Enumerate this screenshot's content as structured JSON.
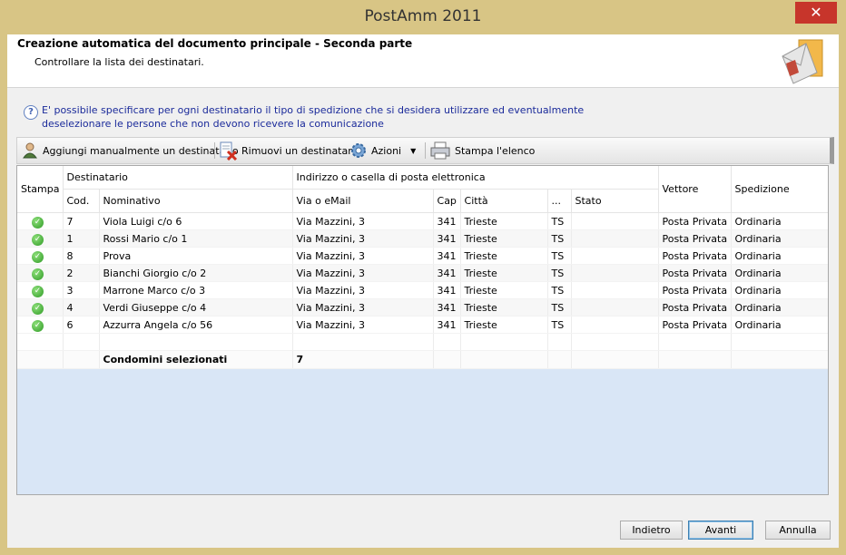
{
  "window": {
    "title": "PostAmm 2011",
    "close_glyph": "✕"
  },
  "header": {
    "title": "Creazione automatica del documento principale - Seconda parte",
    "subtitle": "Controllare la lista dei destinatari."
  },
  "info": {
    "icon": "question-icon",
    "text": "E' possibile specificare per ogni destinatario il tipo di spedizione che si desidera utilizzare ed eventualmente deselezionare le persone che non devono ricevere la comunicazione"
  },
  "toolbar": {
    "add_label": "Aggiungi manualmente un destinatario",
    "remove_label": "Rimuovi un destinatario",
    "actions_label": "Azioni",
    "print_label": "Stampa l'elenco"
  },
  "grid": {
    "group_headers": {
      "stampa": "Stampa",
      "destinatario": "Destinatario",
      "indirizzo": "Indirizzo o casella di posta elettronica",
      "vettore": "Vettore",
      "spedizione": "Spedizione"
    },
    "columns": {
      "cod": "Cod.",
      "nominativo": "Nominativo",
      "via": "Via o eMail",
      "cap": "Cap",
      "citta": "Città",
      "prov": "...",
      "stato": "Stato"
    },
    "rows": [
      {
        "cod": "7",
        "nominativo": "Viola Luigi c/o 6",
        "via": "Via Mazzini, 3",
        "cap": "341",
        "citta": "Trieste",
        "prov": "TS",
        "stato": "",
        "vettore": "Posta Privata",
        "spedizione": "Ordinaria"
      },
      {
        "cod": "1",
        "nominativo": "Rossi Mario c/o 1",
        "via": "Via Mazzini, 3",
        "cap": "341",
        "citta": "Trieste",
        "prov": "TS",
        "stato": "",
        "vettore": "Posta Privata",
        "spedizione": "Ordinaria"
      },
      {
        "cod": "8",
        "nominativo": "Prova",
        "via": "Via Mazzini, 3",
        "cap": "341",
        "citta": "Trieste",
        "prov": "TS",
        "stato": "",
        "vettore": "Posta Privata",
        "spedizione": "Ordinaria"
      },
      {
        "cod": "2",
        "nominativo": "Bianchi Giorgio c/o 2",
        "via": "Via Mazzini, 3",
        "cap": "341",
        "citta": "Trieste",
        "prov": "TS",
        "stato": "",
        "vettore": "Posta Privata",
        "spedizione": "Ordinaria"
      },
      {
        "cod": "3",
        "nominativo": "Marrone Marco c/o 3",
        "via": "Via Mazzini, 3",
        "cap": "341",
        "citta": "Trieste",
        "prov": "TS",
        "stato": "",
        "vettore": "Posta Privata",
        "spedizione": "Ordinaria"
      },
      {
        "cod": "4",
        "nominativo": "Verdi Giuseppe c/o 4",
        "via": "Via Mazzini, 3",
        "cap": "341",
        "citta": "Trieste",
        "prov": "TS",
        "stato": "",
        "vettore": "Posta Privata",
        "spedizione": "Ordinaria"
      },
      {
        "cod": "6",
        "nominativo": "Azzurra Angela c/o 56",
        "via": "Via Mazzini, 3",
        "cap": "341",
        "citta": "Trieste",
        "prov": "TS",
        "stato": "",
        "vettore": "Posta Privata",
        "spedizione": "Ordinaria"
      }
    ],
    "total_label": "Condomini selezionati",
    "total_value": "7"
  },
  "footer": {
    "back_label": "Indietro",
    "next_label": "Avanti",
    "cancel_label": "Annulla"
  },
  "colors": {
    "titlebar": "#d8c585",
    "close": "#c7352b",
    "check": "#2e9a25",
    "grid_empty": "#d9e6f6",
    "info_text": "#1a2a9a"
  }
}
